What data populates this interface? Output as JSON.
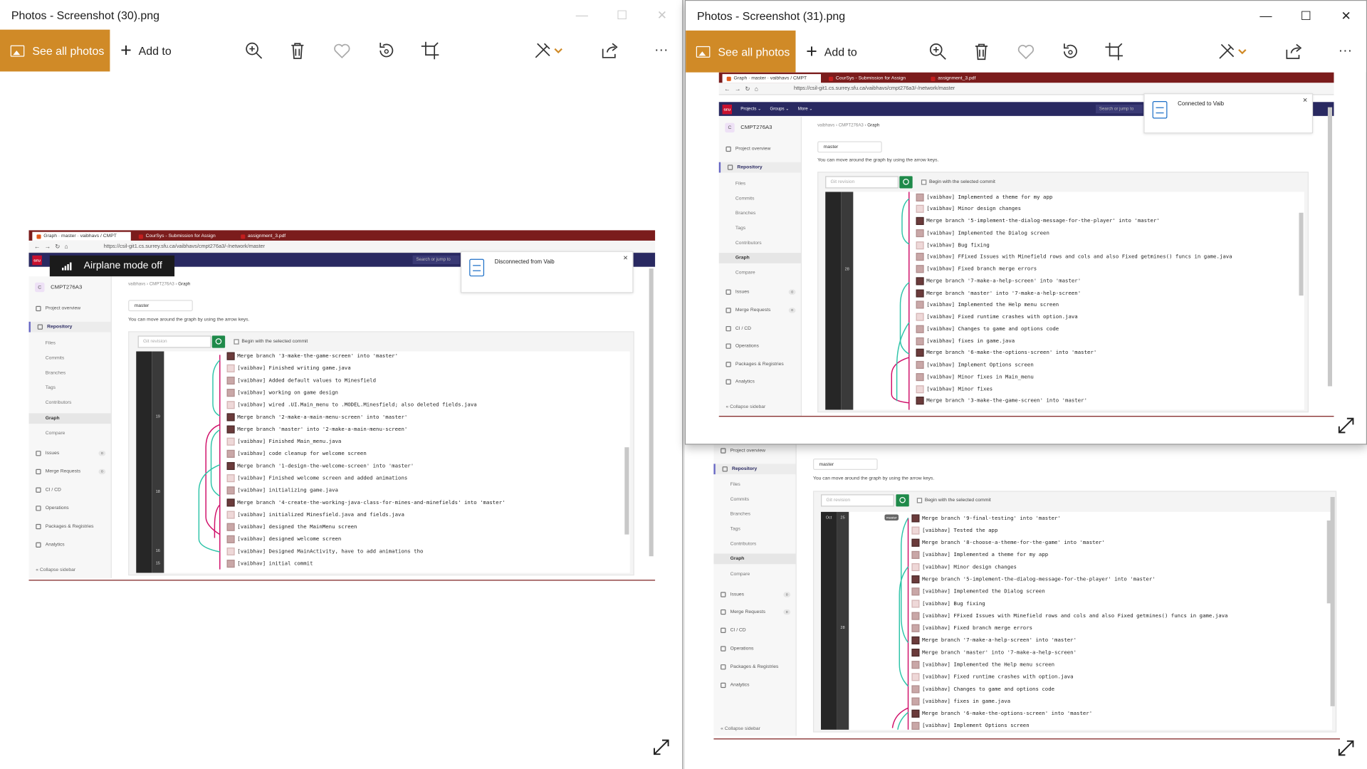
{
  "left_window": {
    "title": "Photos - Screenshot (30).png",
    "toolbar": {
      "see_all": "See all photos",
      "add_to": "Add to"
    },
    "shot": {
      "tabs": [
        "Graph · master · vaibhavs / CMPT",
        "CourSys - Submission for Assign",
        "assignment_3.pdf"
      ],
      "url": "https://csil-git1.cs.surrey.sfu.ca/vaibhavs/cmpt276a3/-/network/master",
      "nav_search": "Search or jump to",
      "airplane": "Airplane mode off",
      "toast": "Disconnected from Vaib",
      "project": {
        "initial": "C",
        "name": "CMPT276A3"
      },
      "breadcrumb": {
        "a": "vaibhavs",
        "b": "CMPT276A3",
        "c": "Graph"
      },
      "branch": "master",
      "hint": "You can move around the graph by using the arrow keys.",
      "git_revision": "Git revision",
      "checkbox": "Begin with the selected commit",
      "date_labels": [
        "19",
        "18",
        "16",
        "15"
      ],
      "commits": [
        "Merge branch '3-make-the-game-screen' into 'master'",
        "[vaibhav] Finished writing game.java",
        "[vaibhav] Added default values to Minesfield",
        "[vaibhav] working on game design",
        "[vaibhav] wired .UI.Main_menu to .MODEL.Minesfield; also deleted fields.java",
        "Merge branch '2-make-a-main-menu-screen' into 'master'",
        "Merge branch 'master' into '2-make-a-main-menu-screen'",
        "[vaibhav] Finished Main_menu.java",
        "[vaibhav] code cleanup for welcome screen",
        "Merge branch '1-design-the-welcome-screen' into 'master'",
        "[vaibhav] Finished welcome screen and added animations",
        "[vaibhav] initializing game.java",
        "Merge branch '4-create-the-working-java-class-for-mines-and-minefields' into 'master'",
        "[vaibhav] initialized Minesfield.java and fields.java",
        "[vaibhav] designed the MainMenu screen",
        "[vaibhav] designed welcome screen",
        "[vaibhav] Designed MainActivity, have to add animations tho",
        "[vaibhav] initial commit"
      ]
    }
  },
  "sidebar": {
    "project_overview": "Project overview",
    "repository": "Repository",
    "sub": [
      "Files",
      "Commits",
      "Branches",
      "Tags",
      "Contributors",
      "Graph",
      "Compare"
    ],
    "issues": "Issues",
    "merge_requests": "Merge Requests",
    "ci_cd": "CI / CD",
    "operations": "Operations",
    "packages": "Packages & Registries",
    "analytics": "Analytics",
    "collapse": "Collapse sidebar",
    "count": "0",
    "nav_menus": [
      "Projects ⌄",
      "Groups ⌄",
      "More ⌄"
    ]
  },
  "right_window": {
    "title": "Photos - Screenshot (31).png",
    "toolbar": {
      "see_all": "See all photos",
      "add_to": "Add to"
    },
    "shot": {
      "url": "https://csil-git1.cs.surrey.sfu.ca/vaibhavs/cmpt276a3/-/network/master",
      "toast": "Connected to Vaib",
      "date_labels": [
        "28"
      ],
      "commits": [
        "[vaibhav] Implemented a theme for my app",
        "[vaibhav] Minor design changes",
        "Merge branch '5-implement-the-dialog-message-for-the-player' into 'master'",
        "[vaibhav] Implemented the Dialog screen",
        "[vaibhav] Bug fixing",
        "[vaibhav] FFixed Issues with Minefield rows and cols and also Fixed getmines() funcs in game.java",
        "[vaibhav] Fixed branch merge errors",
        "Merge branch '7-make-a-help-screen' into 'master'",
        "Merge branch 'master' into '7-make-a-help-screen'",
        "[vaibhav] Implemented the Help menu screen",
        "[vaibhav] Fixed runtime crashes with option.java",
        "[vaibhav] Changes to game and options code",
        "[vaibhav] fixes in game.java",
        "Merge branch '6-make-the-options-screen' into 'master'",
        "[vaibhav] Implement Options screen",
        "[vaibhav] Minor fixes in Main_menu",
        "[vaibhav] Minor fixes",
        "Merge branch '3-make-the-game-screen' into 'master'"
      ]
    }
  },
  "back_window": {
    "shot": {
      "branch": "master",
      "hint": "You can move around the graph by using the arrow keys.",
      "git_revision": "Git revision",
      "checkbox": "Begin with the selected commit",
      "date_labels": {
        "month": "Oct",
        "day1": "25",
        "day2": "28"
      },
      "tag": "master",
      "commits": [
        "Merge branch '9-final-testing' into 'master'",
        "[vaibhav] Tested the app",
        "Merge branch '8-choose-a-theme-for-the-game' into 'master'",
        "[vaibhav] Implemented a theme for my app",
        "[vaibhav] Minor design changes",
        "Merge branch '5-implement-the-dialog-message-for-the-player' into 'master'",
        "[vaibhav] Implemented the Dialog screen",
        "[vaibhav] Bug fixing",
        "[vaibhav] FFixed Issues with Minefield rows and cols and also Fixed getmines() funcs in game.java",
        "[vaibhav] Fixed branch merge errors",
        "Merge branch '7-make-a-help-screen' into 'master'",
        "Merge branch 'master' into '7-make-a-help-screen'",
        "[vaibhav] Implemented the Help menu screen",
        "[vaibhav] Fixed runtime crashes with option.java",
        "[vaibhav] Changes to game and options code",
        "[vaibhav] fixes in game.java",
        "Merge branch '6-make-the-options-screen' into 'master'",
        "[vaibhav] Implement Options screen"
      ]
    }
  },
  "icons": [
    "zoom-in-icon",
    "delete-icon",
    "heart-icon",
    "rotate-icon",
    "crop-icon",
    "edit-icon",
    "share-icon",
    "more-icon",
    "expand-icon"
  ],
  "colors": {
    "accent": "#d08a27",
    "gitlab_nav": "#292961",
    "browser_chrome": "#7b1c1c",
    "search_button": "#1f8a4a"
  }
}
